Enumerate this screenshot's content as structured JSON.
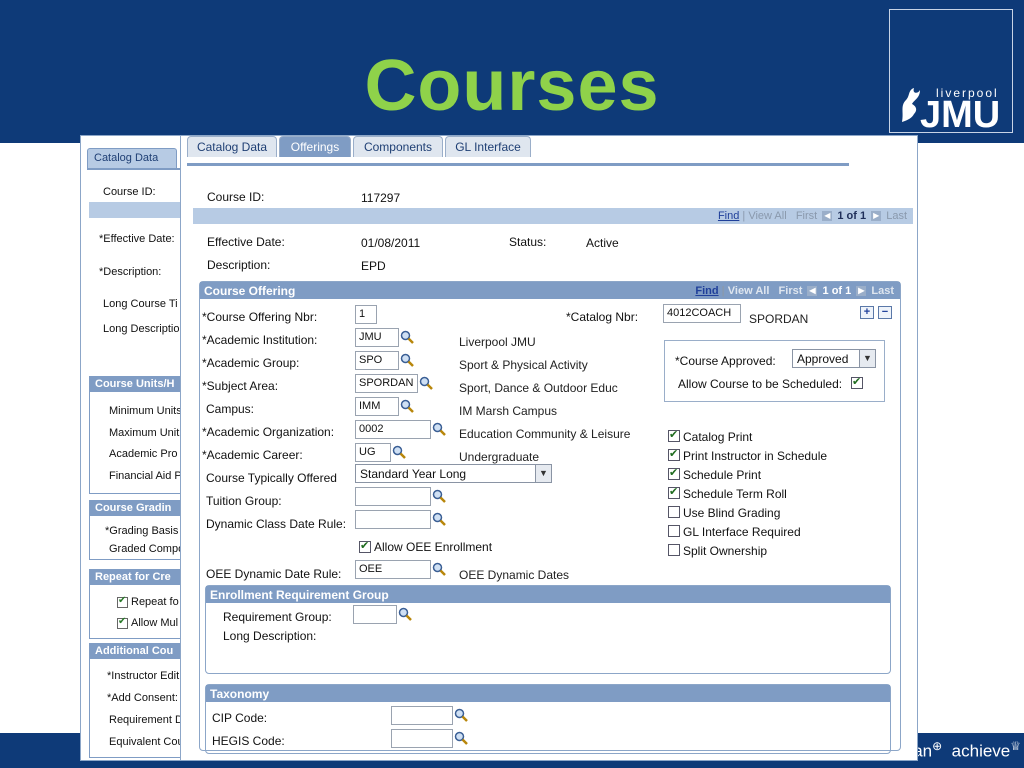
{
  "slide": {
    "title": "Courses",
    "logo": {
      "small": "liverpool",
      "big": "JMU"
    },
    "tagline": {
      "left": "plan",
      "right": "achieve"
    }
  },
  "back_window": {
    "tab": "Catalog Data",
    "labels": {
      "course_id": "Course ID:",
      "effective_date": "*Effective Date:",
      "description": "*Description:",
      "long_course_title": "Long Course Ti",
      "long_description": "Long Descriptio",
      "minimum_units": "Minimum Units",
      "maximum_units": "Maximum Unit",
      "academic_progress": "Academic Pro",
      "financial_aid": "Financial Aid P",
      "grading_basis": "*Grading Basis",
      "graded_component": "Graded Compo",
      "repeat_for": "Repeat fo",
      "allow_multiple": "Allow Mul",
      "instructor_edit": "*Instructor Edit",
      "add_consent": "*Add Consent:",
      "requirement": "Requirement D",
      "equivalent_course": "Equivalent Cou"
    },
    "sections": {
      "course_units": "Course Units/H",
      "course_grading": "Course Gradin",
      "repeat_for_credit": "Repeat for Cre",
      "additional_course": "Additional Cou"
    }
  },
  "tabs": [
    {
      "label": "Catalog Data",
      "active": false
    },
    {
      "label": "Offerings",
      "active": true
    },
    {
      "label": "Components",
      "active": false
    },
    {
      "label": "GL Interface",
      "active": false
    }
  ],
  "header": {
    "course_id_label": "Course ID:",
    "course_id_value": "117297"
  },
  "grid_nav": {
    "find": "Find",
    "view_all": "View All",
    "first": "First",
    "count": "1 of 1",
    "last": "Last"
  },
  "effective": {
    "effective_date_label": "Effective Date:",
    "effective_date_value": "01/08/2011",
    "status_label": "Status:",
    "status_value": "Active",
    "description_label": "Description:",
    "description_value": "EPD"
  },
  "offering": {
    "section_title": "Course Offering",
    "offering_nbr_label": "*Course Offering Nbr:",
    "offering_nbr_value": "1",
    "catalog_nbr_label": "*Catalog Nbr:",
    "catalog_nbr_value": "4012COACH",
    "catalog_nbr_desc": "SPORDAN",
    "institution_label": "*Academic Institution:",
    "institution_value": "JMU",
    "institution_desc": "Liverpool JMU",
    "group_label": "*Academic Group:",
    "group_value": "SPO",
    "group_desc": "Sport & Physical Activity",
    "subject_label": "*Subject Area:",
    "subject_value": "SPORDAN",
    "subject_desc": "Sport, Dance & Outdoor Educ",
    "campus_label": "Campus:",
    "campus_value": "IMM",
    "campus_desc": "IM Marsh Campus",
    "organization_label": "*Academic Organization:",
    "organization_value": "0002",
    "organization_desc": "Education Community & Leisure",
    "career_label": "*Academic Career:",
    "career_value": "UG",
    "career_desc": "Undergraduate",
    "typically_offered_label": "Course Typically Offered",
    "typically_offered_value": "Standard Year Long",
    "tuition_group_label": "Tuition Group:",
    "tuition_group_value": "",
    "dynamic_class_label": "Dynamic Class Date Rule:",
    "dynamic_class_value": "",
    "allow_oee_label": "Allow OEE Enrollment",
    "allow_oee_checked": true,
    "oee_rule_label": "OEE Dynamic Date Rule:",
    "oee_rule_value": "OEE",
    "oee_rule_desc": "OEE Dynamic Dates"
  },
  "approval": {
    "approved_label": "*Course Approved:",
    "approved_value": "Approved",
    "allow_schedule_label": "Allow Course to be Scheduled:",
    "allow_schedule_checked": true
  },
  "options": [
    {
      "label": "Catalog Print",
      "checked": true
    },
    {
      "label": "Print Instructor in Schedule",
      "checked": true
    },
    {
      "label": "Schedule Print",
      "checked": true
    },
    {
      "label": "Schedule Term Roll",
      "checked": true
    },
    {
      "label": "Use Blind Grading",
      "checked": false
    },
    {
      "label": "GL Interface Required",
      "checked": false
    },
    {
      "label": "Split Ownership",
      "checked": false
    }
  ],
  "enrollment": {
    "section_title": "Enrollment Requirement Group",
    "req_group_label": "Requirement Group:",
    "req_group_value": "",
    "long_desc_label": "Long Description:"
  },
  "taxonomy": {
    "section_title": "Taxonomy",
    "cip_label": "CIP Code:",
    "cip_value": "",
    "hegis_label": "HEGIS Code:",
    "hegis_value": ""
  },
  "colors": {
    "slide_blue": "#0e3a78",
    "title_green": "#8fd24a",
    "section_blue": "#7f9cc4",
    "grid_blue": "#b7cbe4"
  },
  "icons": [
    "lookup-icon",
    "add-row-icon",
    "delete-row-icon",
    "dropdown-arrow-icon",
    "first-arrow-icon",
    "last-arrow-icon"
  ]
}
